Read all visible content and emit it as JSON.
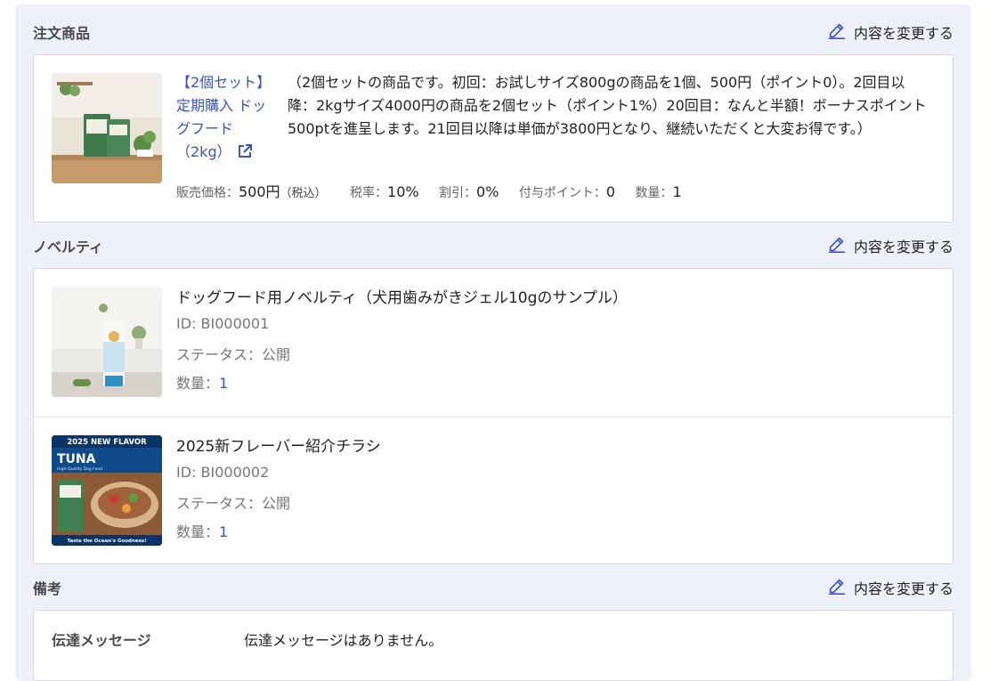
{
  "order": {
    "title": "注文商品",
    "edit_label": "内容を変更する",
    "product": {
      "name": "【2個セット】定期購入 ドッグフード（2kg）",
      "description": "（2個セットの商品です。初回：お試しサイズ800gの商品を1個、500円（ポイント0）。2回目以降：2kgサイズ4000円の商品を2個セット（ポイント1%）20回目：なんと半額！ボーナスポイント500ptを進呈します。21回目以降は単価が3800円となり、継続いただくと大変お得です。）",
      "price_label": "販売価格：",
      "price_value": "500円",
      "price_tax": "（税込）",
      "tax_label": "税率：",
      "tax_value": "10%",
      "discount_label": "割引：",
      "discount_value": "0%",
      "points_label": "付与ポイント：",
      "points_value": "0",
      "qty_label": "数量：",
      "qty_value": "1"
    }
  },
  "novelty": {
    "title": "ノベルティ",
    "edit_label": "内容を変更する",
    "items": [
      {
        "name": "ドッグフード用ノベルティ（犬用歯みがきジェル10gのサンプル）",
        "id": "ID: BI000001",
        "status": "ステータス：公開",
        "qty_label": "数量：",
        "qty_value": "1"
      },
      {
        "name": "2025新フレーバー紹介チラシ",
        "id": "ID: BI000002",
        "status": "ステータス：公開",
        "qty_label": "数量：",
        "qty_value": "1",
        "image_text": {
          "banner": "2025 NEW FLAVOR",
          "brand": "TUNA",
          "tagline": "High-Quality Dog Food",
          "footer": "Taste the Ocean's Goodness!"
        }
      }
    ]
  },
  "remarks": {
    "title": "備考",
    "edit_label": "内容を変更する",
    "message_label": "伝達メッセージ",
    "message_value": "伝達メッセージはありません。"
  },
  "colors": {
    "accent": "#3a52c4",
    "panel_bg": "#eef1fa",
    "border": "#d6d9e2"
  }
}
